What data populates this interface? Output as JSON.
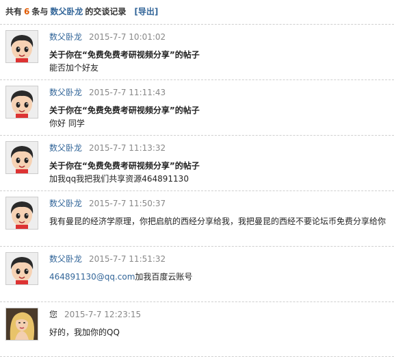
{
  "header": {
    "prefix": "共有",
    "count": "6",
    "mid": "条与",
    "user": "数父卧龙",
    "suffix": "的交谈记录",
    "export_label": "[导出]"
  },
  "messages": [
    {
      "name": "数父卧龙",
      "time": "2015-7-7 10:01:02",
      "subject": "关于你在“免费免费考研视频分享”的帖子",
      "text": "能否加个好友"
    },
    {
      "name": "数父卧龙",
      "time": "2015-7-7 11:11:43",
      "subject": "关于你在“免费免费考研视频分享”的帖子",
      "text": "你好 同学"
    },
    {
      "name": "数父卧龙",
      "time": "2015-7-7 11:13:32",
      "subject": "关于你在“免费免费考研视频分享”的帖子",
      "text": "加我qq我把我们共享资源464891130"
    },
    {
      "name": "数父卧龙",
      "time": "2015-7-7 11:50:37",
      "text": "我有曼昆的经济学原理，你把启航的西经分享给我，我把曼昆的西经不要论坛币免费分享给你"
    },
    {
      "name": "数父卧龙",
      "time": "2015-7-7 11:51:32",
      "email": "464891130@qq.com",
      "text": "加我百度云账号"
    },
    {
      "name": "您",
      "time": "2015-7-7 12:23:15",
      "text": "好的，我加你的QQ"
    }
  ]
}
